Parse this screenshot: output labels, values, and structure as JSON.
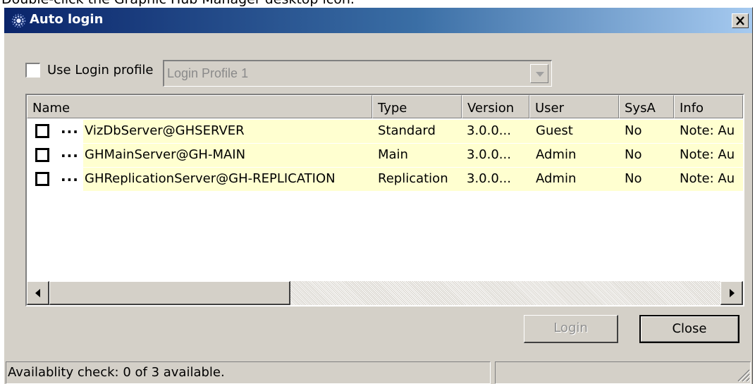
{
  "instruction": "Double-click the Graphic Hub Manager desktop icon.",
  "window": {
    "title": "Auto login",
    "close_glyph": "✕"
  },
  "profile": {
    "checkbox_label": "Use Login profile",
    "checked": false,
    "selected": "Login Profile 1",
    "enabled": false
  },
  "table": {
    "columns": [
      "Name",
      "Type",
      "Version",
      "User",
      "SysA",
      "Info"
    ],
    "rows": [
      {
        "dots": "...",
        "name": "VizDbServer@GHSERVER",
        "type": "Standard",
        "version": "3.0.0...",
        "user": "Guest",
        "sysa": "No",
        "info": "Note: Au"
      },
      {
        "dots": "...",
        "name": "GHMainServer@GH-MAIN",
        "type": "Main",
        "version": "3.0.0...",
        "user": "Admin",
        "sysa": "No",
        "info": "Note: Au"
      },
      {
        "dots": "...",
        "name": "GHReplicationServer@GH-REPLICATION",
        "type": "Replication",
        "version": "3.0.0...",
        "user": "Admin",
        "sysa": "No",
        "info": "Note: Au"
      }
    ],
    "row_highlight_color": "#ffffd0"
  },
  "buttons": {
    "login_label": "Login",
    "login_enabled": false,
    "close_label": "Close"
  },
  "status": {
    "text": "Availablity check: 0 of 3 available.",
    "secondary": ""
  },
  "colors": {
    "dialog_face": "#d4d0c8",
    "title_gradient_start": "#0a246a",
    "title_gradient_end": "#a6caf0"
  }
}
